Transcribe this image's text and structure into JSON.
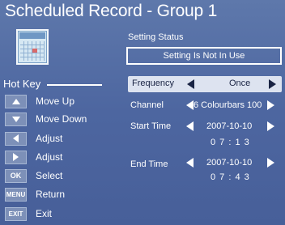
{
  "title": "Scheduled Record - Group 1",
  "icon": "calendar-icon",
  "hotkey": {
    "title": "Hot Key",
    "items": [
      {
        "key_icon": "arrow-up",
        "key_text": "",
        "label": "Move Up"
      },
      {
        "key_icon": "arrow-down",
        "key_text": "",
        "label": "Move Down"
      },
      {
        "key_icon": "arrow-left",
        "key_text": "",
        "label": "Adjust"
      },
      {
        "key_icon": "arrow-right",
        "key_text": "",
        "label": "Adjust"
      },
      {
        "key_icon": "",
        "key_text": "OK",
        "label": "Select"
      },
      {
        "key_icon": "",
        "key_text": "MENU",
        "label": "Return"
      },
      {
        "key_icon": "",
        "key_text": "EXIT",
        "label": "Exit"
      }
    ]
  },
  "settings": {
    "section_title": "Setting Status",
    "status": "Setting Is Not In Use",
    "frequency": {
      "label": "Frequency",
      "value": "Once"
    },
    "channel": {
      "label": "Channel",
      "value": "6 Colourbars 100"
    },
    "start_time": {
      "label": "Start Time",
      "date": "2007-10-10",
      "time": "0 7 : 1 3"
    },
    "end_time": {
      "label": "End Time",
      "date": "2007-10-10",
      "time": "0 7 : 4 3"
    }
  },
  "colors": {
    "background": "#5e78ab",
    "highlight_bar": "#dde3f0",
    "text": "#ffffff",
    "key_bg": "#7d90b8"
  }
}
